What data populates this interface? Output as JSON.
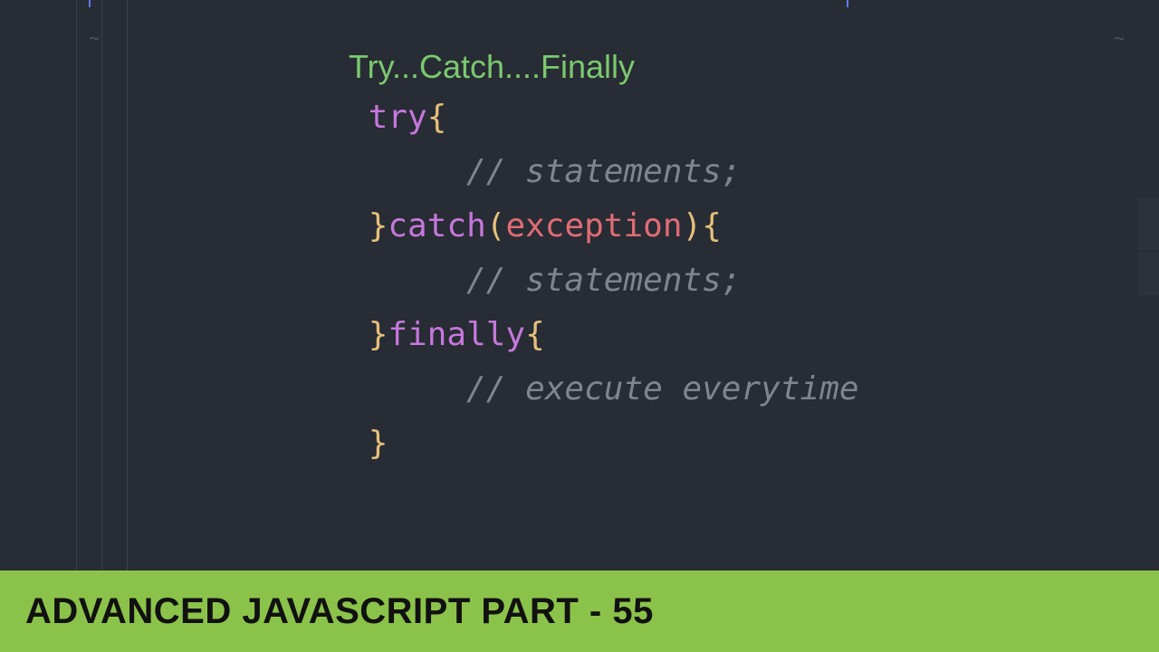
{
  "editor": {
    "title": "Try...Catch....Finally",
    "code": {
      "try_kw": "try",
      "brace_open1": "{",
      "comment1": "// statements;",
      "brace_close1": "}",
      "catch_kw": "catch",
      "paren_open": "(",
      "param": "exception",
      "paren_close": ")",
      "brace_open2": "{",
      "comment2": "// statements;",
      "brace_close2": "}",
      "finally_kw": "finally",
      "brace_open3": "{",
      "comment3": "// execute everytime",
      "brace_close3": "}"
    }
  },
  "banner": {
    "text": "ADVANCED JAVASCRIPT PART - 55"
  },
  "colors": {
    "editor_bg": "#282c34",
    "banner_bg": "#8bc34a",
    "keyword": "#c678dd",
    "brace": "#e5c07b",
    "param": "#e06c75",
    "comment": "#7f848e",
    "title": "#7bc96f"
  }
}
